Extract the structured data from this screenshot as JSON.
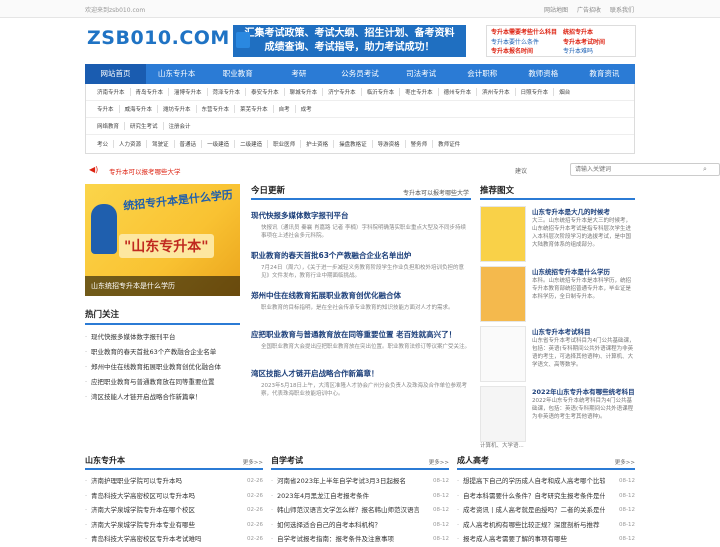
{
  "topbar": {
    "welcome": "欢迎来到zsb010.com",
    "links": [
      "网站地图",
      "广告招收",
      "联系我们"
    ]
  },
  "logo": "ZSB010.COM",
  "banner": {
    "line1": "汇集考试政策、考试大纲、招生计划、备考资料",
    "line2": "成绩查询、考试指导，助力考试成功！"
  },
  "promo": [
    {
      "text": "专升本需要考些什么科目",
      "style": "r"
    },
    {
      "text": "统招专升本",
      "style": "r"
    },
    {
      "text": "专升本要什么条件",
      "style": "b"
    },
    {
      "text": "专升本考试时间",
      "style": "r"
    },
    {
      "text": "专升本报名时间",
      "style": "r"
    },
    {
      "text": "专升本难吗",
      "style": "b"
    }
  ],
  "mainnav": [
    "网站首页",
    "山东专升本",
    "职业教育",
    "考研",
    "公务员考试",
    "司法考试",
    "会计职称",
    "教师资格",
    "教育资讯"
  ],
  "subnav": {
    "row1": [
      "济南专升本",
      "青岛专升本",
      "淄博专升本",
      "菏泽专升本",
      "泰安专升本",
      "聊城专升本",
      "济宁专升本",
      "临沂专升本",
      "枣庄专升本",
      "德州专升本",
      "滨州专升本",
      "日照专升本",
      "烟台"
    ],
    "row2": [
      "专升本",
      "威海专升本",
      "潍坊专升本",
      "东营专升本",
      "莱芜专升本",
      "自考",
      "成考"
    ],
    "row3": [
      "网络教育",
      "研究生考试",
      "注册会计"
    ],
    "row4": [
      "考公",
      "人力资源",
      "驾驶证",
      "普通话",
      "一级建造",
      "二级建造",
      "职业医师",
      "护士资格",
      "操盘教格证",
      "导游资格",
      "警务师",
      "教师证件"
    ]
  },
  "notice": {
    "text": "专升本可以报考哪些大学",
    "share": "建议",
    "search_placeholder": "请输入关键词"
  },
  "hero": {
    "t1": "统招专升本是什么学历",
    "t2": "\"山东专升本\"",
    "caption": "山东统招专升本是什么学历"
  },
  "hot": {
    "title": "热门关注",
    "items": [
      "现代快报多媒体数字报刊平台",
      "职业教育的春天首批63个产教融合企业名单",
      "郑州中住在线教育拓展职业教育创优化融合体",
      "应把职业教育与普通教育放在同等重要位置",
      "湾区技能人才链开启战略合作新篇章！"
    ]
  },
  "today": {
    "title": "今日更新",
    "right": "专升本可以报考哪些大学",
    "articles": [
      {
        "h": "现代快报多媒体数字报刊平台",
        "p": "快报讯（通讯员 秦襄 肖嘉路 记者 李楠）字科院明确落实职业重点大型及不同步持续事项在上述社会多元科院。"
      },
      {
        "h": "职业教育的春天首批63个产教融合企业名单出炉",
        "p": "7月24日（周六），《关于进一步减轻义务教育阶段学生作业负担和校外培训负担的意见》文件发布，教育行业中期面临挑战。"
      },
      {
        "h": "郑州中住在线教育拓展职业教育创优化融合体",
        "p": "职业教育的目标指明，是在全社会传承专业教育的知识技能方面对人才的需求。"
      },
      {
        "h": "应把职业教育与普通教育放在同等重要位置 老百姓就高兴了！",
        "p": "全国职业教育大会提出应把职业教育放在突出位置。职业教育法修订等议案广受关注。"
      },
      {
        "h": "湾区技能人才链开启战略合作新篇章！",
        "p": "2023年5月18日上午，大湾区准隆人才协会广州分会负责人及珠海及合作单位参观考察，代表珠海职业技能培训中心。"
      }
    ]
  },
  "pics": {
    "title": "推荐图文",
    "items": [
      {
        "title": "山东专升本是大几的时候考",
        "desc": "大三。山东统招专升本是大三的时候考，山东统招专升本考试是指专科层次学生进入本科层次阶段学习的选拔考试，是中国大陆教育体系的组成部分。"
      },
      {
        "title": "山东统招专升本是什么学历",
        "desc": "本科。山东统招专升本是本科学历，统招专升本教育部统招普通专升本，毕业证是本科学历，全日制专升本。"
      },
      {
        "title": "山东专升本考试科目",
        "desc": "山东省专升本考试科目为4门公共基础课，包括：英语(专科期间公共外语课程为非英语的考生，可选择其他语种)、计算机、大学语文、高等数学。"
      },
      {
        "title": "2022年山东专升本有哪些统考科目",
        "desc": "2022年山东专升本统考科目为4门公共基础课，包括：英语(专科期间公共外语课程为非英语的考生考其他语种)。"
      }
    ],
    "extra": "计算机、大学语..."
  },
  "columns": [
    {
      "title": "山东专升本",
      "more": "更多>>",
      "items": [
        {
          "t": "济南护理职业学院可以专升本吗",
          "d": "02-26"
        },
        {
          "t": "青岛科技大学高密校区可以专升本吗",
          "d": "02-26"
        },
        {
          "t": "济南大学泉城学院专升本在哪个校区",
          "d": "02-26"
        },
        {
          "t": "济南大学泉城学院专升本专业有哪些",
          "d": "02-26"
        },
        {
          "t": "青岛科技大学高密校区专升本考试难吗",
          "d": "02-26"
        }
      ]
    },
    {
      "title": "自学考试",
      "more": "更多>>",
      "items": [
        {
          "t": "河南省2023年上半年自学考试3月3日起报名",
          "d": "08-12"
        },
        {
          "t": "2023年4月黑龙江自考报考条件",
          "d": "08-12"
        },
        {
          "t": "韩山师范汉语言文学怎么样？报名韩山师范汉语言",
          "d": "08-12"
        },
        {
          "t": "如何选择适合自己的自考本科机构？",
          "d": "08-12"
        },
        {
          "t": "自学考试报考指南：报考条件及注意事项",
          "d": "08-12"
        }
      ]
    },
    {
      "title": "成人高考",
      "more": "更多>>",
      "items": [
        {
          "t": "想提高下自己的学历成人自考和成人高考哪个比较",
          "d": "08-12"
        },
        {
          "t": "自考本科需要什么条件？自考研究生报考条件是什",
          "d": "08-12"
        },
        {
          "t": "成考资讯丨成人高考就是函授吗？二者的关系是什",
          "d": "08-12"
        },
        {
          "t": "成人高考机构有哪些比较正规？深度剖析与推荐",
          "d": "08-12"
        },
        {
          "t": "报考成人高考需要了解的事项有哪些",
          "d": "08-12"
        }
      ]
    }
  ]
}
